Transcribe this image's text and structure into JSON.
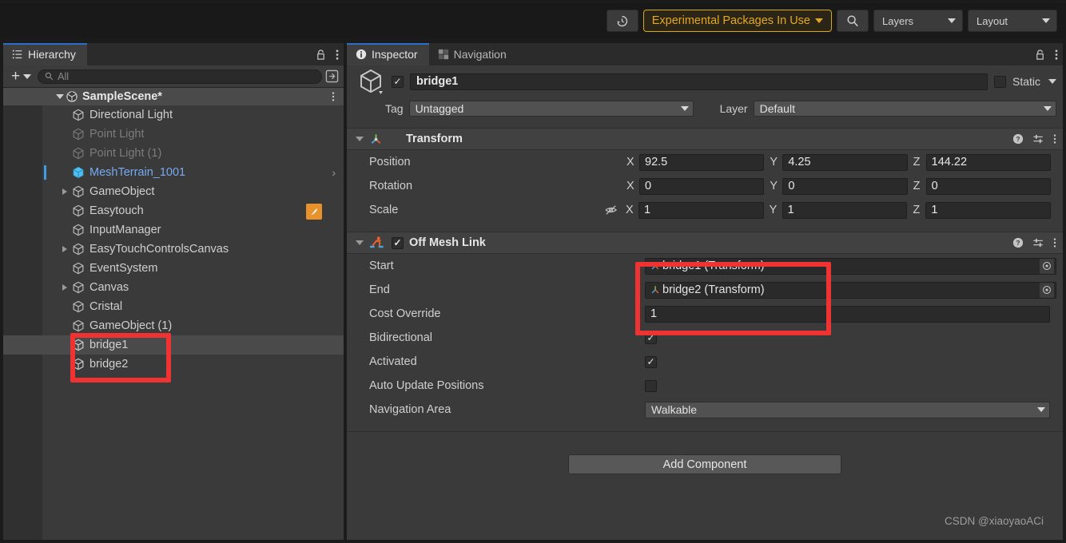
{
  "toolbar": {
    "history_icon": "history-clock-icon",
    "experimental_label": "Experimental Packages In Use",
    "search_icon": "search-icon",
    "layers_label": "Layers",
    "layout_label": "Layout"
  },
  "hierarchy": {
    "tab_label": "Hierarchy",
    "tab_icon": "hierarchy-list-icon",
    "lock_icon": "lock-icon",
    "menu_icon": "kebab-menu-icon",
    "create_label": "+",
    "search": {
      "placeholder": "All",
      "icon": "search-icon"
    },
    "scene": {
      "name": "SampleScene*",
      "icon": "unity-scene-icon"
    },
    "items": [
      {
        "label": "Directional Light",
        "state": "normal",
        "foldout": false
      },
      {
        "label": "Point Light",
        "state": "disabled",
        "foldout": false
      },
      {
        "label": "Point Light (1)",
        "state": "disabled",
        "foldout": false
      },
      {
        "label": "MeshTerrain_1001",
        "state": "prefab",
        "foldout": false
      },
      {
        "label": "GameObject",
        "state": "normal",
        "foldout": true
      },
      {
        "label": "Easytouch",
        "state": "normal",
        "foldout": false
      },
      {
        "label": "InputManager",
        "state": "normal",
        "foldout": false
      },
      {
        "label": "EasyTouchControlsCanvas",
        "state": "normal",
        "foldout": true
      },
      {
        "label": "EventSystem",
        "state": "normal",
        "foldout": false
      },
      {
        "label": "Canvas",
        "state": "normal",
        "foldout": true
      },
      {
        "label": "Cristal",
        "state": "normal",
        "foldout": false
      },
      {
        "label": "GameObject (1)",
        "state": "normal",
        "foldout": false
      },
      {
        "label": "bridge1",
        "state": "selected",
        "foldout": false
      },
      {
        "label": "bridge2",
        "state": "normal",
        "foldout": false
      }
    ]
  },
  "inspector": {
    "tabs": [
      {
        "label": "Inspector",
        "icon": "info-icon",
        "active": true
      },
      {
        "label": "Navigation",
        "icon": "navmesh-icon",
        "active": false
      }
    ],
    "lock_icon": "lock-icon",
    "menu_icon": "kebab-menu-icon",
    "object": {
      "enabled": true,
      "name": "bridge1",
      "icon": "gameobject-cube-icon",
      "static_label": "Static",
      "static_checked": false,
      "tag_label": "Tag",
      "tag_value": "Untagged",
      "layer_label": "Layer",
      "layer_value": "Default"
    },
    "transform": {
      "title": "Transform",
      "icon": "transform-axis-icon",
      "help_icon": "help-icon",
      "preset_icon": "preset-sliders-icon",
      "menu_icon": "kebab-menu-icon",
      "rows": [
        {
          "label": "Position",
          "x": "92.5",
          "y": "4.25",
          "z": "144.22",
          "extra_icon": ""
        },
        {
          "label": "Rotation",
          "x": "0",
          "y": "0",
          "z": "0",
          "extra_icon": ""
        },
        {
          "label": "Scale",
          "x": "1",
          "y": "1",
          "z": "1",
          "extra_icon": "eye-slash-icon"
        }
      ],
      "axis_labels": {
        "x": "X",
        "y": "Y",
        "z": "Z"
      }
    },
    "off_mesh_link": {
      "title": "Off Mesh Link",
      "icon": "off-mesh-link-icon",
      "enabled": true,
      "help_icon": "help-icon",
      "preset_icon": "preset-sliders-icon",
      "menu_icon": "kebab-menu-icon",
      "start_label": "Start",
      "start_value": "bridge1 (Transform)",
      "end_label": "End",
      "end_value": "bridge2 (Transform)",
      "cost_override_label": "Cost Override",
      "cost_override_value": "1",
      "bidirectional_label": "Bidirectional",
      "bidirectional_checked": true,
      "activated_label": "Activated",
      "activated_checked": true,
      "auto_update_label": "Auto Update Positions",
      "auto_update_checked": false,
      "nav_area_label": "Navigation Area",
      "nav_area_value": "Walkable",
      "field_icon": "transform-axis-icon",
      "picker_icon": "object-picker-icon"
    },
    "add_component_label": "Add Component",
    "watermark": "CSDN @xiaoyaoACi"
  },
  "annotations": {
    "hierarchy_highlight": "red-box-bridge-objects",
    "inspector_highlight": "red-box-start-end-fields"
  }
}
